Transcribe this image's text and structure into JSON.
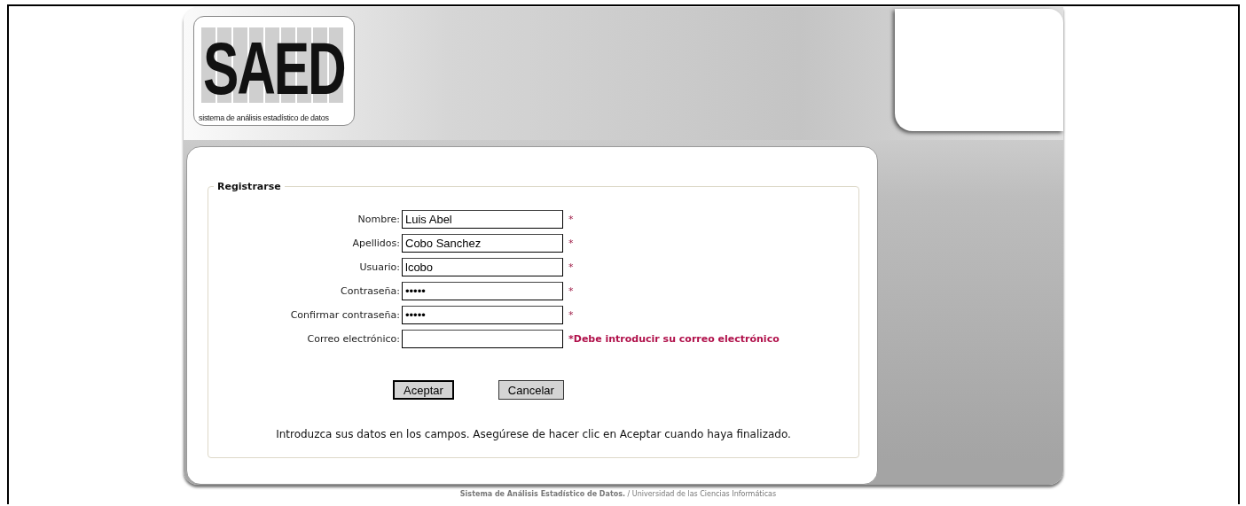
{
  "logo": {
    "title": "SAED",
    "subtitle": "sistema de análisis estadístico de datos"
  },
  "form": {
    "legend": "Registrarse",
    "fields": [
      {
        "label": "Nombre:",
        "kind": "text",
        "value": "Luis Abel",
        "marker": "*"
      },
      {
        "label": "Apellidos:",
        "kind": "text",
        "value": "Cobo Sanchez",
        "marker": "*"
      },
      {
        "label": "Usuario:",
        "kind": "text",
        "value": "lcobo",
        "marker": "*"
      },
      {
        "label": "Contraseña:",
        "kind": "password",
        "value": "•••••",
        "marker": "*"
      },
      {
        "label": "Confirmar contraseña:",
        "kind": "password",
        "value": "•••••",
        "marker": "*"
      },
      {
        "label": "Correo electrónico:",
        "kind": "text",
        "marker": "*Debe introducir su correo electrónico"
      }
    ],
    "buttons": [
      {
        "label": "Aceptar",
        "default": true
      },
      {
        "label": "Cancelar",
        "default": false
      }
    ],
    "note": "Introduzca sus datos en los campos. Asegúrese de hacer clic en Aceptar cuando haya finalizado."
  },
  "footer": "**Sistema de Análisis Estadístico de Datos.** / Universidad de las Ciencias Informáticas"
}
